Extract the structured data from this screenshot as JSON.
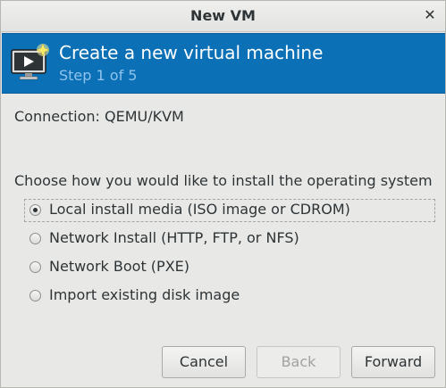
{
  "window": {
    "title": "New VM",
    "close_glyph": "✕"
  },
  "header": {
    "title": "Create a new virtual machine",
    "step": "Step 1 of 5",
    "icon": "vm-screen-play-icon",
    "background_color": "#0b70b5"
  },
  "connection": {
    "text": "Connection: QEMU/KVM"
  },
  "install": {
    "prompt": "Choose how you would like to install the operating system",
    "options": [
      {
        "label": "Local install media (ISO image or CDROM)",
        "selected": true
      },
      {
        "label": "Network Install (HTTP, FTP, or NFS)",
        "selected": false
      },
      {
        "label": "Network Boot (PXE)",
        "selected": false
      },
      {
        "label": "Import existing disk image",
        "selected": false
      }
    ]
  },
  "buttons": {
    "cancel": "Cancel",
    "back": "Back",
    "forward": "Forward"
  }
}
